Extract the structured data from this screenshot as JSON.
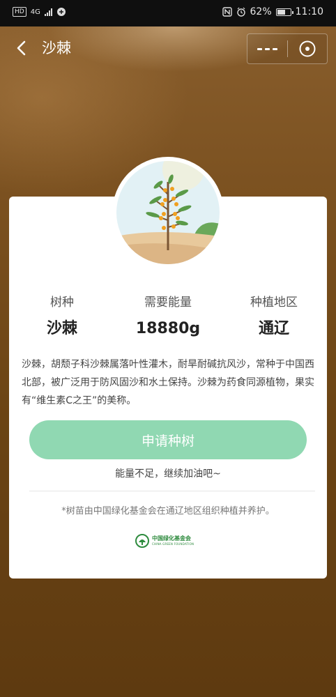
{
  "status_bar": {
    "network_badge": "HD",
    "network_type": "4G",
    "battery_percent": "62%",
    "battery_level": 0.62,
    "time": "11:10",
    "icons": [
      "nfc-icon",
      "alarm-icon",
      "battery-icon",
      "signal-icon",
      "wifi-icon"
    ]
  },
  "header": {
    "title": "沙棘",
    "back_icon": "chevron-left-icon",
    "more_icon": "more-dots-icon",
    "close_icon": "close-circle-icon"
  },
  "card": {
    "stats": [
      {
        "label": "树种",
        "value": "沙棘"
      },
      {
        "label": "需要能量",
        "value": "18880g"
      },
      {
        "label": "种植地区",
        "value": "通辽"
      }
    ],
    "description": "沙棘，胡颓子科沙棘属落叶性灌木，耐旱耐碱抗风沙，常种于中国西北部，被广泛用于防风固沙和水土保持。沙棘为药食同源植物，果实有“维生素C之王”的美称。",
    "apply_button": "申请种树",
    "hint": "能量不足，继续加油吧~",
    "footnote": "*树苗由中国绿化基金会在通辽地区组织种植并养护。",
    "logo": {
      "name_cn": "中国绿化基金会",
      "name_en": "CHINA GREEN FOUNDATION"
    }
  },
  "colors": {
    "background": "#6b4414",
    "button": "#90d8b2",
    "card": "#ffffff",
    "logo_green": "#2e8b3e"
  }
}
